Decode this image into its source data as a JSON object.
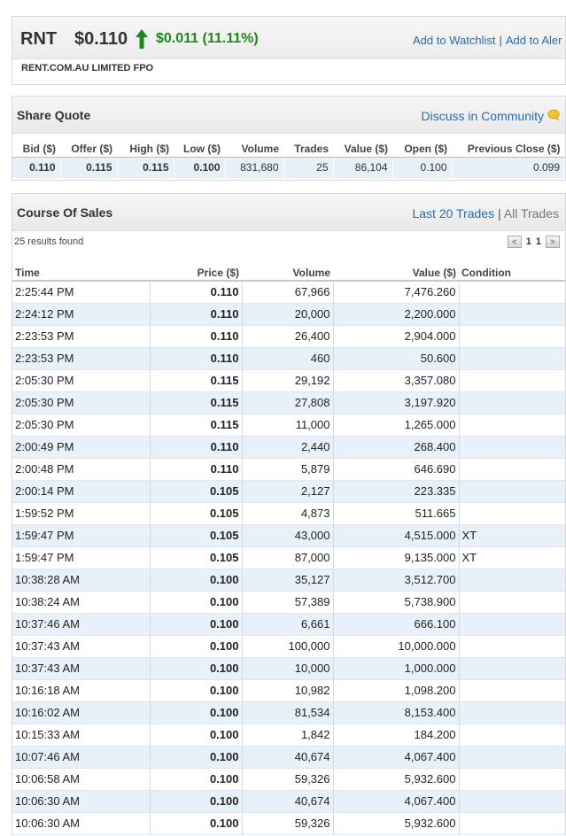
{
  "header": {
    "code": "RNT",
    "price": "$0.110",
    "change": "$0.011 (11.11%)",
    "watchlist": "Add to Watchlist",
    "sep": "|",
    "alert": "Add to Aler",
    "company": "RENT.COM.AU LIMITED FPO",
    "up_color": "#1a8a1a"
  },
  "quote": {
    "title": "Share Quote",
    "community": "Discuss in Community",
    "headers": [
      "Bid ($)",
      "Offer ($)",
      "High ($)",
      "Low ($)",
      "Volume",
      "Trades",
      "Value ($)",
      "Open ($)",
      "Previous Close ($)"
    ],
    "values": [
      "0.110",
      "0.115",
      "0.115",
      "0.100",
      "831,680",
      "25",
      "86,104",
      "0.100",
      "0.099"
    ]
  },
  "sales": {
    "title": "Course Of Sales",
    "tab_last": "Last 20 Trades",
    "tab_sep": "|",
    "tab_all": "All Trades",
    "results": "25 results found",
    "page_current": "1",
    "page_total": "1",
    "prev_icon": "<",
    "next_icon": ">",
    "headers": [
      "Time",
      "Price ($)",
      "Volume",
      "Value ($)",
      "Condition"
    ],
    "rows": [
      [
        "2:25:44 PM",
        "0.110",
        "67,966",
        "7,476.260",
        ""
      ],
      [
        "2:24:12 PM",
        "0.110",
        "20,000",
        "2,200.000",
        ""
      ],
      [
        "2:23:53 PM",
        "0.110",
        "26,400",
        "2,904.000",
        ""
      ],
      [
        "2:23:53 PM",
        "0.110",
        "460",
        "50.600",
        ""
      ],
      [
        "2:05:30 PM",
        "0.115",
        "29,192",
        "3,357.080",
        ""
      ],
      [
        "2:05:30 PM",
        "0.115",
        "27,808",
        "3,197.920",
        ""
      ],
      [
        "2:05:30 PM",
        "0.115",
        "11,000",
        "1,265.000",
        ""
      ],
      [
        "2:00:49 PM",
        "0.110",
        "2,440",
        "268.400",
        ""
      ],
      [
        "2:00:48 PM",
        "0.110",
        "5,879",
        "646.690",
        ""
      ],
      [
        "2:00:14 PM",
        "0.105",
        "2,127",
        "223.335",
        ""
      ],
      [
        "1:59:52 PM",
        "0.105",
        "4,873",
        "511.665",
        ""
      ],
      [
        "1:59:47 PM",
        "0.105",
        "43,000",
        "4,515.000",
        "XT"
      ],
      [
        "1:59:47 PM",
        "0.105",
        "87,000",
        "9,135.000",
        "XT"
      ],
      [
        "10:38:28 AM",
        "0.100",
        "35,127",
        "3,512.700",
        ""
      ],
      [
        "10:38:24 AM",
        "0.100",
        "57,389",
        "5,738.900",
        ""
      ],
      [
        "10:37:46 AM",
        "0.100",
        "6,661",
        "666.100",
        ""
      ],
      [
        "10:37:43 AM",
        "0.100",
        "100,000",
        "10,000.000",
        ""
      ],
      [
        "10:37:43 AM",
        "0.100",
        "10,000",
        "1,000.000",
        ""
      ],
      [
        "10:16:18 AM",
        "0.100",
        "10,982",
        "1,098.200",
        ""
      ],
      [
        "10:16:02 AM",
        "0.100",
        "81,534",
        "8,153.400",
        ""
      ],
      [
        "10:15:33 AM",
        "0.100",
        "1,842",
        "184.200",
        ""
      ],
      [
        "10:07:46 AM",
        "0.100",
        "40,674",
        "4,067.400",
        ""
      ],
      [
        "10:06:58 AM",
        "0.100",
        "59,326",
        "5,932.600",
        ""
      ],
      [
        "10:06:30 AM",
        "0.100",
        "40,674",
        "4,067.400",
        ""
      ],
      [
        "10:06:30 AM",
        "0.100",
        "59,326",
        "5,932.600",
        ""
      ]
    ]
  }
}
